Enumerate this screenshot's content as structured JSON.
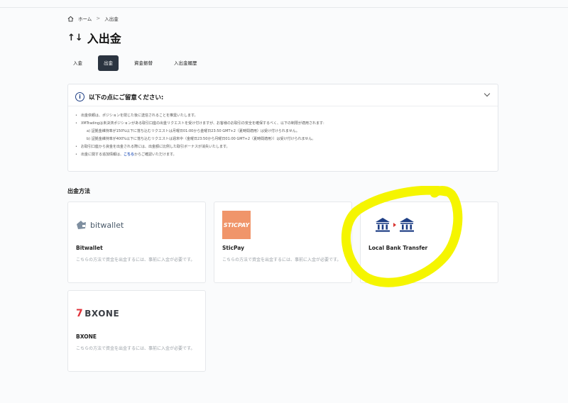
{
  "breadcrumb": {
    "home": "ホーム",
    "sep": ">",
    "current": "入出金"
  },
  "page": {
    "title_icon": "↑↓",
    "title": "入出金"
  },
  "tabs": [
    {
      "label": "入金",
      "active": false
    },
    {
      "label": "出金",
      "active": true
    },
    {
      "label": "資金振替",
      "active": false
    },
    {
      "label": "入出金履歴",
      "active": false
    }
  ],
  "notice": {
    "icon": "info-icon",
    "title": "以下の点にご留意ください:",
    "items": [
      "出金依頼は、ポジションを閉じた後に送信されることを推奨いたします。",
      "XMTradingは未決済ポジションがある取引口座の出金リクエストを受け付けますが、お客様のお取引の安全を確保するべく、以下の制限が適用されます:",
      "a) 証拠金維持率が150%以下に落ち込むリクエストは月曜日01:00から金曜日23:50 GMT+2（夏時間適用）は受け付けられません。",
      "b) 証拠金維持率が400%以下に落ち込むリクエストは週末中（金曜日23:50から月曜日01:00 GMT+2（夏時間適用））は受け付けられません。",
      "お取引口座から資金を出金される際には、出金額に比例した取引ボーナスが消失いたします。"
    ],
    "last_item_prefix": "出金に関する追加情報は、",
    "last_item_link": "こちら",
    "last_item_suffix": "からご確認いただけます。"
  },
  "section_title": "出金方法",
  "methods": [
    {
      "name": "Bitwallet",
      "logo_text": "bitwallet",
      "desc": "こちらの方法で資金を出金するには、事前に入金が必要です。"
    },
    {
      "name": "SticPay",
      "logo_text": "STICPAY",
      "desc": "こちらの方法で資金を出金するには、事前に入金が必要です。"
    },
    {
      "name": "Local Bank Transfer",
      "logo_text": "",
      "desc": ""
    },
    {
      "name": "BXONE",
      "logo_text": "BXONE",
      "desc": "こちらの方法で資金を出金するには、事前に入金が必要です。"
    }
  ],
  "colors": {
    "active_tab": "#2b3440",
    "bank": "#1f3f85",
    "sticpay": "#f0956a",
    "highlight": "#f5f500",
    "bxone_accent": "#e0323a"
  }
}
